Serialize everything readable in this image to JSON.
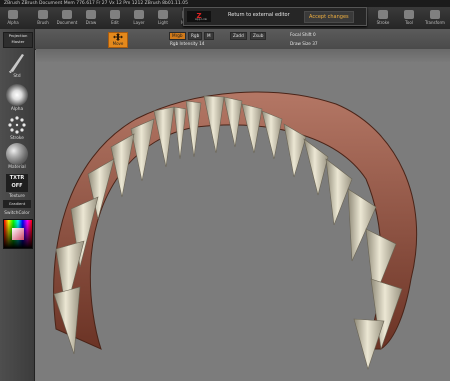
{
  "window": {
    "title": "ZBrush ZBrush Document    Mem 776.617  Fr 27  Vx 12  Pm 1212    ZBrush 8b01.11.05"
  },
  "menubar": {
    "items": [
      "Alpha",
      "Brush",
      "Document",
      "Draw",
      "Edit",
      "Layer",
      "Light",
      "Macro",
      "",
      "",
      "",
      "",
      "",
      "Stroke",
      "Tool",
      "Transform"
    ]
  },
  "goz_popup": {
    "logo": "Z",
    "sub": "App Link",
    "return_label": "Return to external editor",
    "accept_label": "Accept changes"
  },
  "toolbar": {
    "move_label": "Move",
    "mrgb": "Mrgb",
    "rgb": "Rgb",
    "m": "M",
    "zadd": "Zadd",
    "zsub": "Zsub",
    "rgb_intensity": "Rgb Intensity 14",
    "focal_shift": "Focal Shift 0",
    "draw_size": "Draw Size 37"
  },
  "sidebar": {
    "projection_master": "Projection Master",
    "brush_label": "Std",
    "alpha_label": "Alpha",
    "stroke_label": "Stroke",
    "material_label": "Material",
    "texture_label": "TXTR OFF",
    "texture_sub": "Texture",
    "gradient_label": "Gradient",
    "switch_color": "SwitchColor"
  },
  "colors": {
    "accent": "#e4891c",
    "viewport": "#7c7c7c",
    "gum": "#8b4a3a",
    "teeth": "#d8d3c0"
  }
}
